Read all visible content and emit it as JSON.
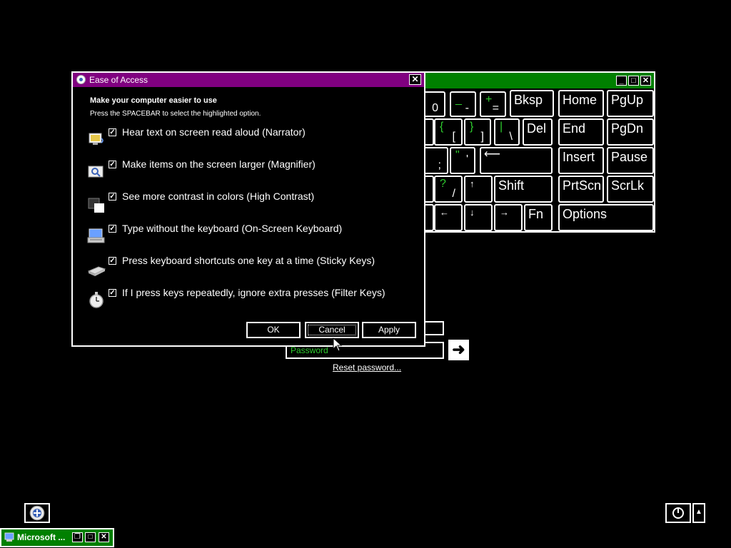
{
  "osk": {
    "keys": {
      "zero": "0",
      "minus_up": "_",
      "minus_low": "-",
      "equals_up": "+",
      "equals_low": "=",
      "bksp": "Bksp",
      "home": "Home",
      "pgup": "PgUp",
      "lbrace_up": "{",
      "lbrace_low": "[",
      "rbrace_up": "}",
      "rbrace_low": "]",
      "pipe_up": "|",
      "pipe_low": "\\",
      "del": "Del",
      "end": "End",
      "pgdn": "PgDn",
      "semicolon_low": ";",
      "quote_up": "\"",
      "quote_low": "'",
      "enter": "⟵",
      "insert": "Insert",
      "pause": "Pause",
      "slash_up": "?",
      "slash_low": "/",
      "up": "↑",
      "shift": "Shift",
      "prtscn": "PrtScn",
      "scrlk": "ScrLk",
      "left": "←",
      "down": "↓",
      "right": "→",
      "fn": "Fn",
      "options": "Options"
    }
  },
  "dialog": {
    "title": "Ease of Access",
    "close": "✕",
    "heading": "Make your computer easier to use",
    "subheading": "Press the SPACEBAR to select the highlighted option.",
    "options": [
      {
        "label": "Hear text on screen read aloud (Narrator)",
        "checked": true,
        "icon": "narrator-icon"
      },
      {
        "label": "Make items on the screen larger (Magnifier)",
        "checked": true,
        "icon": "magnifier-icon"
      },
      {
        "label": "See more contrast in colors (High Contrast)",
        "checked": true,
        "icon": "high-contrast-icon"
      },
      {
        "label": "Type without the keyboard (On-Screen Keyboard)",
        "checked": true,
        "icon": "keyboard-icon"
      },
      {
        "label": "Press keyboard shortcuts one key at a time (Sticky Keys)",
        "checked": true,
        "icon": "sticky-keys-icon"
      },
      {
        "label": "If I press keys repeatedly, ignore extra presses (Filter Keys)",
        "checked": true,
        "icon": "stopwatch-icon"
      }
    ],
    "check_mark": "✓",
    "ok": "OK",
    "cancel": "Cancel",
    "apply": "Apply"
  },
  "login": {
    "password_placeholder": "Password",
    "go": "➜",
    "reset_link": "Reset password..."
  },
  "taskbar": {
    "item_label": "Microsoft ..."
  }
}
